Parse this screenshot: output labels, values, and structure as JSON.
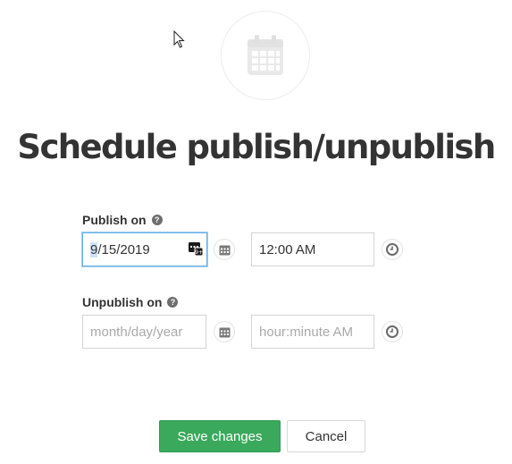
{
  "header": {
    "icon": "calendar-icon",
    "title": "Schedule publish/unpublish"
  },
  "publish": {
    "label": "Publish on",
    "help_icon": "question-circle-icon",
    "date_value_month": "9",
    "date_value_rest": "/15/2019",
    "date_picker_icon": "calendar-icon",
    "time_value": "12:00 AM",
    "time_picker_icon": "clock-icon"
  },
  "unpublish": {
    "label": "Unpublish on",
    "help_icon": "question-circle-icon",
    "date_placeholder": "month/day/year",
    "date_picker_icon": "calendar-icon",
    "time_placeholder": "hour:minute AM",
    "time_picker_icon": "clock-icon"
  },
  "actions": {
    "save_label": "Save changes",
    "cancel_label": "Cancel"
  },
  "colors": {
    "primary": "#3aa95c",
    "focus": "#66afe9",
    "text": "#333333",
    "placeholder": "#a9a9a9"
  }
}
